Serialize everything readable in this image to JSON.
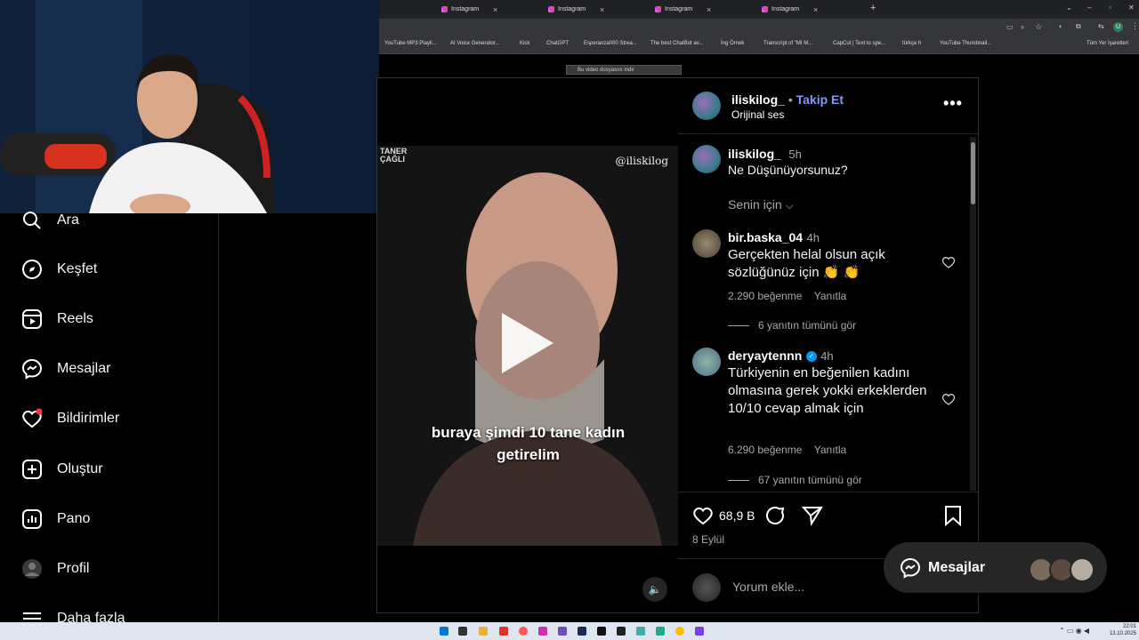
{
  "browser": {
    "tabs": [
      {
        "label": "Instagram"
      },
      {
        "label": "Instagram"
      },
      {
        "label": "Instagram"
      },
      {
        "label": "Instagram"
      }
    ],
    "bookmarks": [
      "YouTube MP3 Playli...",
      "AI Voice Generator...",
      "Kick",
      "ChatGPT",
      "Esperanza000 Strea...",
      "The best ChatBot av...",
      "İng Örnek",
      "Transcript of \"MI M...",
      "CapCut | Text to spe...",
      "türkçe h",
      "YouTube Thumbnail...",
      "Tüm Yer İşaretleri"
    ],
    "profile_letter": "U",
    "download_banner": "Bu video dosyasını indir"
  },
  "sidebar": {
    "items": [
      {
        "label": "Ara",
        "icon": "search-icon"
      },
      {
        "label": "Keşfet",
        "icon": "compass-icon"
      },
      {
        "label": "Reels",
        "icon": "reels-icon"
      },
      {
        "label": "Mesajlar",
        "icon": "messenger-icon"
      },
      {
        "label": "Bildirimler",
        "icon": "heart-icon"
      },
      {
        "label": "Oluştur",
        "icon": "plus-square-icon"
      },
      {
        "label": "Pano",
        "icon": "dashboard-icon"
      },
      {
        "label": "Profil",
        "icon": "avatar"
      },
      {
        "label": "Daha fazla",
        "icon": "menu-icon"
      }
    ]
  },
  "video": {
    "watermark_left": "TANER ÇAĞLI",
    "watermark_right": "@iliskilog",
    "subtitle_line1": "buraya şimdi 10 tane kadın",
    "subtitle_line2": "getirelim"
  },
  "post": {
    "username": "iliskilog_",
    "follow_label": "Takip Et",
    "audio": "Orijinal ses",
    "caption_user": "iliskilog_",
    "caption_time": "5h",
    "caption": "Ne Düşünüyorsunuz?",
    "sort_label": "Senin için",
    "comments": [
      {
        "user": "bir.baska_04",
        "time": "4h",
        "text": "Gerçekten helal olsun açık sözlüğünüz için 👏 👏",
        "likes": "2.290 beğenme",
        "reply": "Yanıtla",
        "view_replies": "6 yanıtın tümünü gör"
      },
      {
        "user": "deryaytennn",
        "time": "4h",
        "text": "Türkiyenin en beğenilen kadını olmasına gerek yokki erkeklerden 10/10 cevap almak için",
        "likes": "6.290 beğenme",
        "reply": "Yanıtla",
        "view_replies": "67 yanıtın tümünü gör"
      }
    ],
    "like_count": "68,9 B",
    "date": "8 Eylül",
    "comment_placeholder": "Yorum ekle..."
  },
  "messages_popup": {
    "label": "Mesajlar"
  },
  "taskbar": {
    "time": "22:01",
    "date": "13.10.2025"
  }
}
